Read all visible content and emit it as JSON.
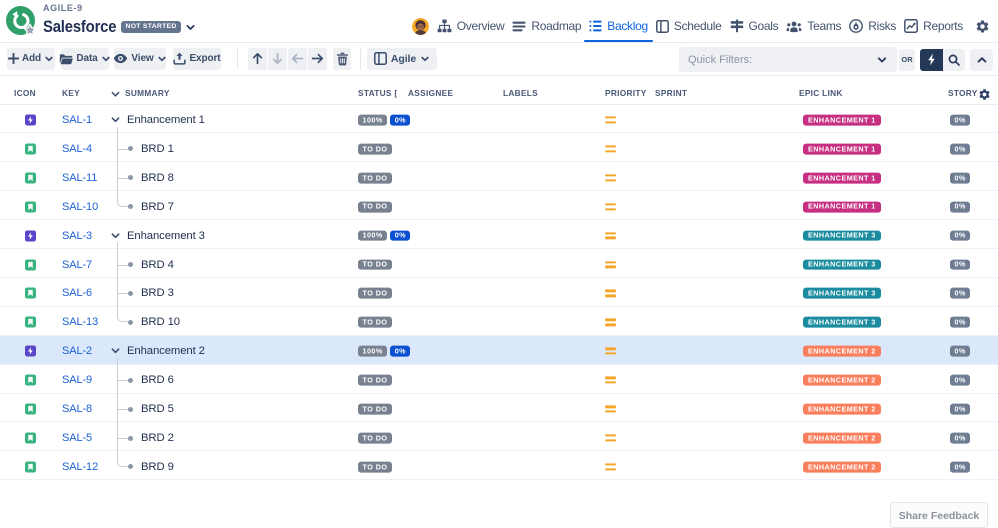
{
  "topbar": {
    "project_label": "AGILE-9",
    "project_name": "Salesforce",
    "status_badge": "NOT STARTED",
    "logo_color": "#2fa06a",
    "nav_items": [
      {
        "label": "Overview",
        "icon": "sitemap-icon",
        "active": false
      },
      {
        "label": "Roadmap",
        "icon": "bars-icon",
        "active": false
      },
      {
        "label": "Backlog",
        "icon": "list-icon",
        "active": true
      },
      {
        "label": "Schedule",
        "icon": "board-icon",
        "active": false
      },
      {
        "label": "Goals",
        "icon": "signpost-icon",
        "active": false
      },
      {
        "label": "Teams",
        "icon": "people-icon",
        "active": false
      },
      {
        "label": "Risks",
        "icon": "flame-icon",
        "active": false
      },
      {
        "label": "Reports",
        "icon": "chart-icon",
        "active": false
      }
    ],
    "active_color": "#0b63e0"
  },
  "toolbar": {
    "buttons_left": [
      {
        "label": "Add",
        "icon": "plus-icon",
        "chevron": true
      },
      {
        "label": "Data",
        "icon": "folder-icon",
        "chevron": true
      },
      {
        "label": "View",
        "icon": "eye-icon",
        "chevron": true
      },
      {
        "label": "Export",
        "icon": "upload-icon",
        "chevron": false
      }
    ],
    "arrow_buttons": [
      {
        "name": "move-up",
        "icon": "arrow-up-icon",
        "enabled": true
      },
      {
        "name": "move-down",
        "icon": "arrow-down-icon",
        "enabled": false
      },
      {
        "name": "outdent",
        "icon": "arrow-left-icon",
        "enabled": false
      },
      {
        "name": "indent",
        "icon": "arrow-right-icon",
        "enabled": true
      }
    ],
    "view_mode": {
      "label": "Agile",
      "icon": "board-icon",
      "chevron": true
    },
    "quick_filters_placeholder": "Quick Filters:",
    "or_label": "OR"
  },
  "table": {
    "columns": [
      "ICON",
      "KEY",
      "SUMMARY",
      "STATUS [C",
      "ASSIGNEE",
      "LABELS",
      "PRIORITY",
      "SPRINT",
      "EPIC LINK",
      "STORY"
    ],
    "epic_colors": {
      "pink": "#c72f80",
      "teal": "#1b8c9f",
      "salmon": "#f97e5c"
    },
    "status_colors": {
      "gray": "#78818f",
      "blue": "#0b4fd1",
      "story": "#6f7d93"
    },
    "type_colors": {
      "epic": "#5a44c8",
      "story": "#36b37e"
    },
    "priority_color": "#f5a62a",
    "selected_row_color": "#dbe8fc",
    "rows": [
      {
        "key": "SAL-1",
        "type": "epic",
        "level": 0,
        "summary": "Enhancement 1",
        "badges": [
          {
            "text": "100%",
            "color": "gray"
          },
          {
            "text": "0%",
            "color": "blue"
          }
        ],
        "priority": "medium",
        "epic": {
          "label": "ENHANCEMENT 1",
          "color": "pink"
        },
        "story": "0%",
        "selected": false,
        "tree": "start"
      },
      {
        "key": "SAL-4",
        "type": "story",
        "level": 1,
        "summary": "BRD 1",
        "badges": [
          {
            "text": "TO DO",
            "color": "gray"
          }
        ],
        "priority": "medium",
        "epic": {
          "label": "ENHANCEMENT 1",
          "color": "pink"
        },
        "story": "0%",
        "selected": false,
        "tree": "mid"
      },
      {
        "key": "SAL-11",
        "type": "story",
        "level": 1,
        "summary": "BRD 8",
        "badges": [
          {
            "text": "TO DO",
            "color": "gray"
          }
        ],
        "priority": "medium",
        "epic": {
          "label": "ENHANCEMENT 1",
          "color": "pink"
        },
        "story": "0%",
        "selected": false,
        "tree": "mid"
      },
      {
        "key": "SAL-10",
        "type": "story",
        "level": 1,
        "summary": "BRD 7",
        "badges": [
          {
            "text": "TO DO",
            "color": "gray"
          }
        ],
        "priority": "medium",
        "epic": {
          "label": "ENHANCEMENT 1",
          "color": "pink"
        },
        "story": "0%",
        "selected": false,
        "tree": "end"
      },
      {
        "key": "SAL-3",
        "type": "epic",
        "level": 0,
        "summary": "Enhancement 3",
        "badges": [
          {
            "text": "100%",
            "color": "gray"
          },
          {
            "text": "0%",
            "color": "blue"
          }
        ],
        "priority": "medium",
        "epic": {
          "label": "ENHANCEMENT 3",
          "color": "teal"
        },
        "story": "0%",
        "selected": false,
        "tree": "start"
      },
      {
        "key": "SAL-7",
        "type": "story",
        "level": 1,
        "summary": "BRD 4",
        "badges": [
          {
            "text": "TO DO",
            "color": "gray"
          }
        ],
        "priority": "medium",
        "epic": {
          "label": "ENHANCEMENT 3",
          "color": "teal"
        },
        "story": "0%",
        "selected": false,
        "tree": "mid"
      },
      {
        "key": "SAL-6",
        "type": "story",
        "level": 1,
        "summary": "BRD 3",
        "badges": [
          {
            "text": "TO DO",
            "color": "gray"
          }
        ],
        "priority": "medium",
        "epic": {
          "label": "ENHANCEMENT 3",
          "color": "teal"
        },
        "story": "0%",
        "selected": false,
        "tree": "mid"
      },
      {
        "key": "SAL-13",
        "type": "story",
        "level": 1,
        "summary": "BRD 10",
        "badges": [
          {
            "text": "TO DO",
            "color": "gray"
          }
        ],
        "priority": "medium",
        "epic": {
          "label": "ENHANCEMENT 3",
          "color": "teal"
        },
        "story": "0%",
        "selected": false,
        "tree": "end"
      },
      {
        "key": "SAL-2",
        "type": "epic",
        "level": 0,
        "summary": "Enhancement 2",
        "badges": [
          {
            "text": "100%",
            "color": "gray"
          },
          {
            "text": "0%",
            "color": "blue"
          }
        ],
        "priority": "medium",
        "epic": {
          "label": "ENHANCEMENT 2",
          "color": "salmon"
        },
        "story": "0%",
        "selected": true,
        "tree": "start"
      },
      {
        "key": "SAL-9",
        "type": "story",
        "level": 1,
        "summary": "BRD 6",
        "badges": [
          {
            "text": "TO DO",
            "color": "gray"
          }
        ],
        "priority": "medium",
        "epic": {
          "label": "ENHANCEMENT 2",
          "color": "salmon"
        },
        "story": "0%",
        "selected": false,
        "tree": "mid"
      },
      {
        "key": "SAL-8",
        "type": "story",
        "level": 1,
        "summary": "BRD 5",
        "badges": [
          {
            "text": "TO DO",
            "color": "gray"
          }
        ],
        "priority": "medium",
        "epic": {
          "label": "ENHANCEMENT 2",
          "color": "salmon"
        },
        "story": "0%",
        "selected": false,
        "tree": "mid"
      },
      {
        "key": "SAL-5",
        "type": "story",
        "level": 1,
        "summary": "BRD 2",
        "badges": [
          {
            "text": "TO DO",
            "color": "gray"
          }
        ],
        "priority": "medium",
        "epic": {
          "label": "ENHANCEMENT 2",
          "color": "salmon"
        },
        "story": "0%",
        "selected": false,
        "tree": "mid"
      },
      {
        "key": "SAL-12",
        "type": "story",
        "level": 1,
        "summary": "BRD 9",
        "badges": [
          {
            "text": "TO DO",
            "color": "gray"
          }
        ],
        "priority": "medium",
        "epic": {
          "label": "ENHANCEMENT 2",
          "color": "salmon"
        },
        "story": "0%",
        "selected": false,
        "tree": "end"
      }
    ]
  },
  "feedback_button_label": "Share Feedback"
}
